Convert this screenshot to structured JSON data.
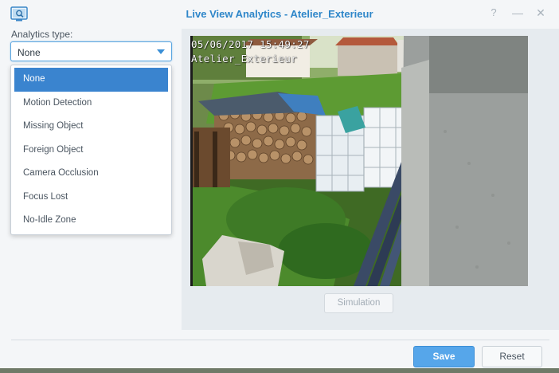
{
  "window": {
    "title": "Live View Analytics - Atelier_Exterieur",
    "help_glyph": "?",
    "minimize_glyph": "—",
    "close_glyph": "✕",
    "accent_color": "#2e86c9"
  },
  "analytics": {
    "label": "Analytics type:",
    "selected": "None",
    "options": [
      {
        "label": "None",
        "selected": true
      },
      {
        "label": "Motion Detection",
        "selected": false
      },
      {
        "label": "Missing Object",
        "selected": false
      },
      {
        "label": "Foreign Object",
        "selected": false
      },
      {
        "label": "Camera Occlusion",
        "selected": false
      },
      {
        "label": "Focus Lost",
        "selected": false
      },
      {
        "label": "No-Idle Zone",
        "selected": false
      }
    ]
  },
  "camera": {
    "timestamp": "05/06/2017 15:49:27",
    "name": "Atelier_Exterieur"
  },
  "buttons": {
    "simulation": "Simulation",
    "save": "Save",
    "reset": "Reset"
  }
}
